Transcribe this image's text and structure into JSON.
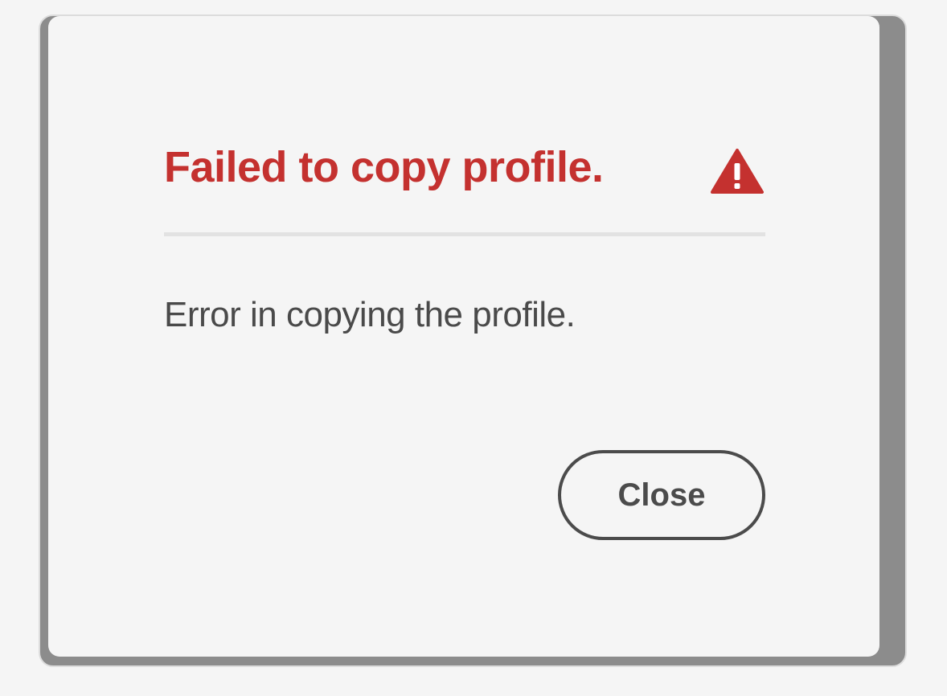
{
  "dialog": {
    "title": "Failed to copy profile.",
    "title_color": "#c4312f",
    "icon": "alert-triangle-icon",
    "message": "Error in copying the profile.",
    "close_label": "Close"
  },
  "colors": {
    "background": "#f5f5f5",
    "shadow": "#8c8c8c",
    "text": "#4a4a4a",
    "button_border": "#4b4b4b"
  }
}
